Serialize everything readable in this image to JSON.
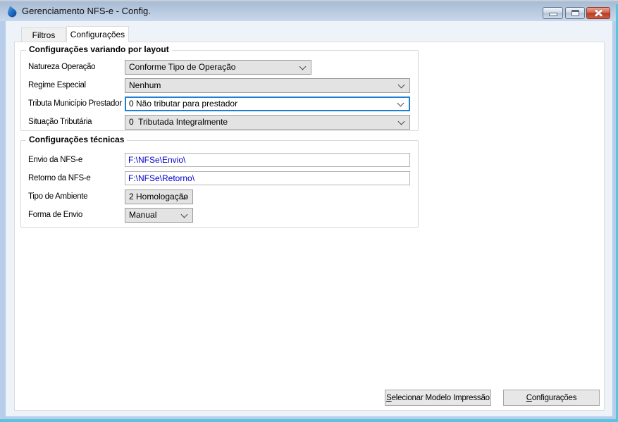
{
  "window": {
    "title": "Gerenciamento NFS-e - Config.",
    "icon": "water-drop-icon"
  },
  "icons": {
    "app": "water-drop-icon",
    "minimize": "minimize-icon",
    "maximize": "maximize-icon",
    "close": "close-icon",
    "dropdown": "chevron-down-icon"
  },
  "tabs": [
    {
      "label": "Filtros",
      "active": false
    },
    {
      "label": "Configurações",
      "active": true
    }
  ],
  "groups": [
    {
      "legend": "Configurações variando por layout",
      "fields": [
        {
          "label": "Natureza Operação",
          "value": "Conforme Tipo de Operação",
          "type": "select",
          "focused": false
        },
        {
          "label": "Regime Especial",
          "value": "Nenhum",
          "type": "select",
          "focused": false
        },
        {
          "label": "Tributa Município Prestador",
          "value": "0 Não tributar para prestador",
          "type": "select",
          "focused": true
        },
        {
          "label": "Situação Tributária",
          "value": "0  Tributada Integralmente",
          "type": "select",
          "focused": false
        }
      ]
    },
    {
      "legend": "Configurações técnicas",
      "fields": [
        {
          "label": "Envio da NFS-e",
          "value": "F:\\NFSe\\Envio\\",
          "type": "text"
        },
        {
          "label": "Retorno da NFS-e",
          "value": "F:\\NFSe\\Retorno\\",
          "type": "text"
        },
        {
          "label": "Tipo de Ambiente",
          "value": "2 Homologação",
          "type": "select",
          "focused": false
        },
        {
          "label": "Forma de Envio",
          "value": "Manual",
          "type": "select",
          "focused": false
        }
      ]
    }
  ],
  "footer": {
    "buttons": [
      {
        "accel": "S",
        "rest": "elecionar Modelo Impressão"
      },
      {
        "accel": "C",
        "rest": "onfigurações"
      }
    ]
  },
  "colors": {
    "titlebar_top": "#a7bbd3",
    "titlebar_bottom": "#c8d8ec",
    "window_border": "#b7cdea",
    "client_bg": "#eef2f9",
    "focus_border": "#1d7fd7",
    "path_text": "#0000cc",
    "close_button": "#ba3a24",
    "edge_glow": "#58c4e1",
    "control_bg": "#e3e3e3"
  }
}
